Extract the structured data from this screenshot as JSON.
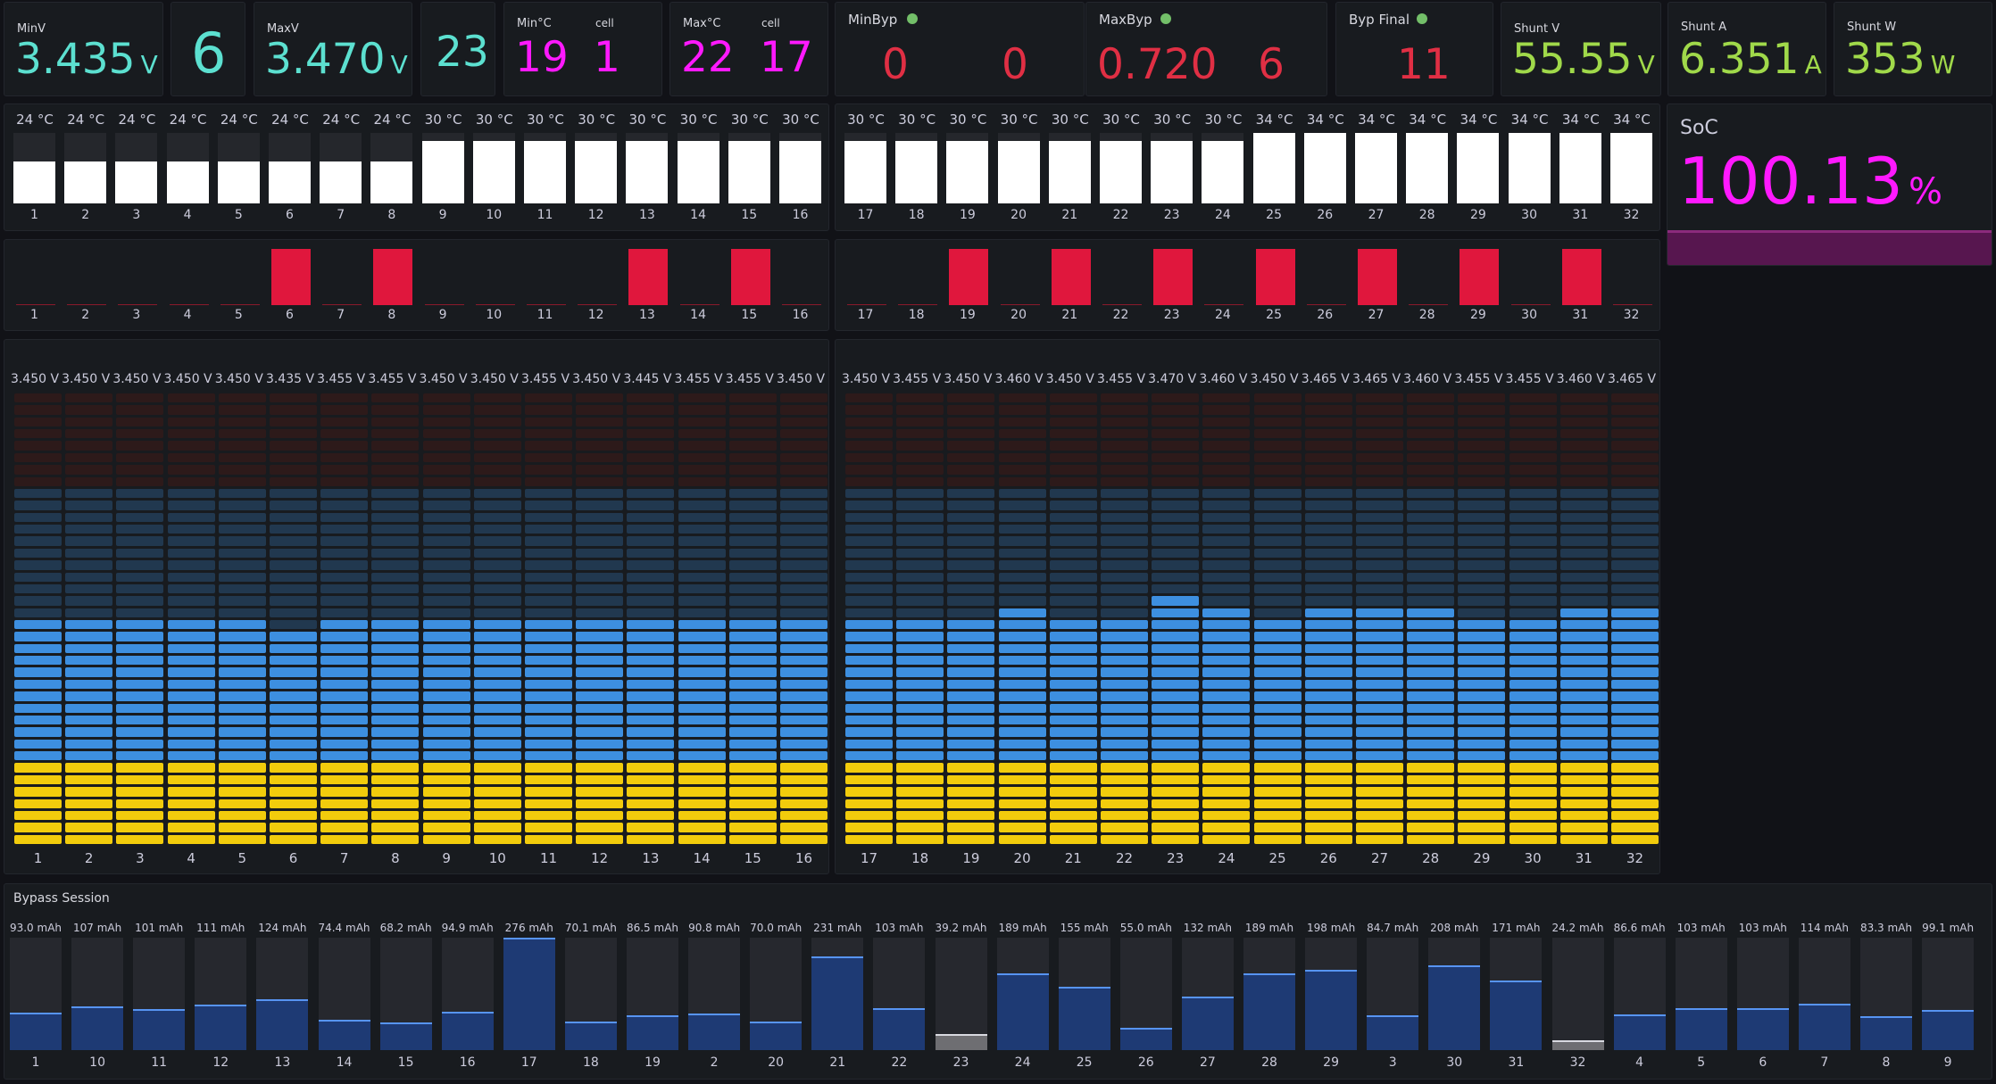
{
  "stats": {
    "minv": {
      "title": "MinV",
      "value": "3.435",
      "unit": "V",
      "color": "#5ce0d0"
    },
    "minv_cell": {
      "value": "6",
      "color": "#5ce0d0"
    },
    "maxv": {
      "title": "MaxV",
      "value": "3.470",
      "unit": "V",
      "color": "#5ce0d0"
    },
    "maxv_cell": {
      "value": "23",
      "color": "#5ce0d0"
    },
    "minc": {
      "title": "Min°C",
      "sub": "cell",
      "value": "19",
      "cell": "1",
      "color": "#ff19ff"
    },
    "maxc": {
      "title": "Max°C",
      "sub": "cell",
      "value": "22",
      "cell": "17",
      "color": "#ff19ff"
    },
    "minbyp": {
      "title": "MinByp",
      "value": "0",
      "cell": "0",
      "color": "#e02f44"
    },
    "maxbyp": {
      "title": "MaxByp",
      "value": "0.720",
      "cell": "6",
      "color": "#e02f44"
    },
    "bypfinal": {
      "title": "Byp Final",
      "value": "11",
      "color": "#e02f44"
    },
    "shuntv": {
      "title": "Shunt V",
      "value": "55.55",
      "unit": "V",
      "color": "#a0d94a"
    },
    "shunta": {
      "title": "Shunt A",
      "value": "6.351",
      "unit": "A",
      "color": "#a0d94a"
    },
    "shuntw": {
      "title": "Shunt W",
      "value": "353",
      "unit": "W",
      "color": "#a0d94a"
    }
  },
  "soc": {
    "title": "SoC",
    "value": "100.13",
    "unit": "%",
    "fraction": 1.0,
    "color": "#ff19ff"
  },
  "cells": {
    "left": {
      "ids": [
        "1",
        "2",
        "3",
        "4",
        "5",
        "6",
        "7",
        "8",
        "9",
        "10",
        "11",
        "12",
        "13",
        "14",
        "15",
        "16"
      ]
    },
    "right": {
      "ids": [
        "17",
        "18",
        "19",
        "20",
        "21",
        "22",
        "23",
        "24",
        "25",
        "26",
        "27",
        "28",
        "29",
        "30",
        "31",
        "32"
      ]
    }
  },
  "temps": {
    "left": [
      "24 °C",
      "24 °C",
      "24 °C",
      "24 °C",
      "24 °C",
      "24 °C",
      "24 °C",
      "24 °C",
      "30 °C",
      "30 °C",
      "30 °C",
      "30 °C",
      "30 °C",
      "30 °C",
      "30 °C",
      "30 °C"
    ],
    "right": [
      "30 °C",
      "30 °C",
      "30 °C",
      "30 °C",
      "30 °C",
      "30 °C",
      "30 °C",
      "30 °C",
      "34 °C",
      "34 °C",
      "34 °C",
      "34 °C",
      "34 °C",
      "34 °C",
      "34 °C",
      "34 °C"
    ],
    "levels_left": [
      0.6,
      0.6,
      0.6,
      0.6,
      0.6,
      0.6,
      0.6,
      0.6,
      0.88,
      0.88,
      0.88,
      0.88,
      0.88,
      0.88,
      0.88,
      0.88
    ],
    "levels_right": [
      0.88,
      0.88,
      0.88,
      0.88,
      0.88,
      0.88,
      0.88,
      0.88,
      1.0,
      1.0,
      1.0,
      1.0,
      1.0,
      1.0,
      1.0,
      1.0
    ]
  },
  "bypass_flags": {
    "left": [
      0,
      0,
      0,
      0,
      0,
      1,
      0,
      1,
      0,
      0,
      0,
      0,
      1,
      0,
      1,
      0
    ],
    "right": [
      0,
      0,
      1,
      0,
      1,
      0,
      1,
      0,
      1,
      0,
      1,
      0,
      1,
      0,
      1,
      0
    ],
    "color": "#e0173d"
  },
  "voltages": {
    "left": [
      "3.450 V",
      "3.450 V",
      "3.450 V",
      "3.450 V",
      "3.450 V",
      "3.435 V",
      "3.455 V",
      "3.455 V",
      "3.450 V",
      "3.450 V",
      "3.455 V",
      "3.450 V",
      "3.445 V",
      "3.455 V",
      "3.455 V",
      "3.450 V"
    ],
    "right": [
      "3.450 V",
      "3.455 V",
      "3.450 V",
      "3.460 V",
      "3.450 V",
      "3.455 V",
      "3.470 V",
      "3.460 V",
      "3.450 V",
      "3.465 V",
      "3.465 V",
      "3.460 V",
      "3.455 V",
      "3.455 V",
      "3.460 V",
      "3.465 V"
    ],
    "left_vals": [
      3.45,
      3.45,
      3.45,
      3.45,
      3.45,
      3.435,
      3.455,
      3.455,
      3.45,
      3.45,
      3.455,
      3.45,
      3.445,
      3.455,
      3.455,
      3.45
    ],
    "right_vals": [
      3.45,
      3.455,
      3.45,
      3.46,
      3.45,
      3.455,
      3.47,
      3.46,
      3.45,
      3.465,
      3.465,
      3.46,
      3.455,
      3.455,
      3.46,
      3.465
    ],
    "colors": {
      "low": "#f2cc0c",
      "mid": "#3d8fe0",
      "high": "#ff780a",
      "off": "#2d1a1a"
    }
  },
  "bypass_session": {
    "title": "Bypass Session",
    "labels": [
      "1",
      "10",
      "11",
      "12",
      "13",
      "14",
      "15",
      "16",
      "17",
      "18",
      "19",
      "2",
      "20",
      "21",
      "22",
      "23",
      "24",
      "25",
      "26",
      "27",
      "28",
      "29",
      "3",
      "30",
      "31",
      "32",
      "4",
      "5",
      "6",
      "7",
      "8",
      "9"
    ],
    "values_text": [
      "93.0 mAh",
      "107 mAh",
      "101 mAh",
      "111 mAh",
      "124 mAh",
      "74.4 mAh",
      "68.2 mAh",
      "94.9 mAh",
      "276 mAh",
      "70.1 mAh",
      "86.5 mAh",
      "90.8 mAh",
      "70.0 mAh",
      "231 mAh",
      "103 mAh",
      "39.2 mAh",
      "189 mAh",
      "155 mAh",
      "55.0 mAh",
      "132 mAh",
      "189 mAh",
      "198 mAh",
      "84.7 mAh",
      "208 mAh",
      "171 mAh",
      "24.2 mAh",
      "86.6 mAh",
      "103 mAh",
      "103 mAh",
      "114 mAh",
      "83.3 mAh",
      "99.1 mAh"
    ],
    "values": [
      93.0,
      107,
      101,
      111,
      124,
      74.4,
      68.2,
      94.9,
      276,
      70.1,
      86.5,
      90.8,
      70.0,
      231,
      103,
      39.2,
      189,
      155,
      55.0,
      132,
      189,
      198,
      84.7,
      208,
      171,
      24.2,
      86.6,
      103,
      103,
      114,
      83.3,
      99.1
    ],
    "max": 276
  }
}
